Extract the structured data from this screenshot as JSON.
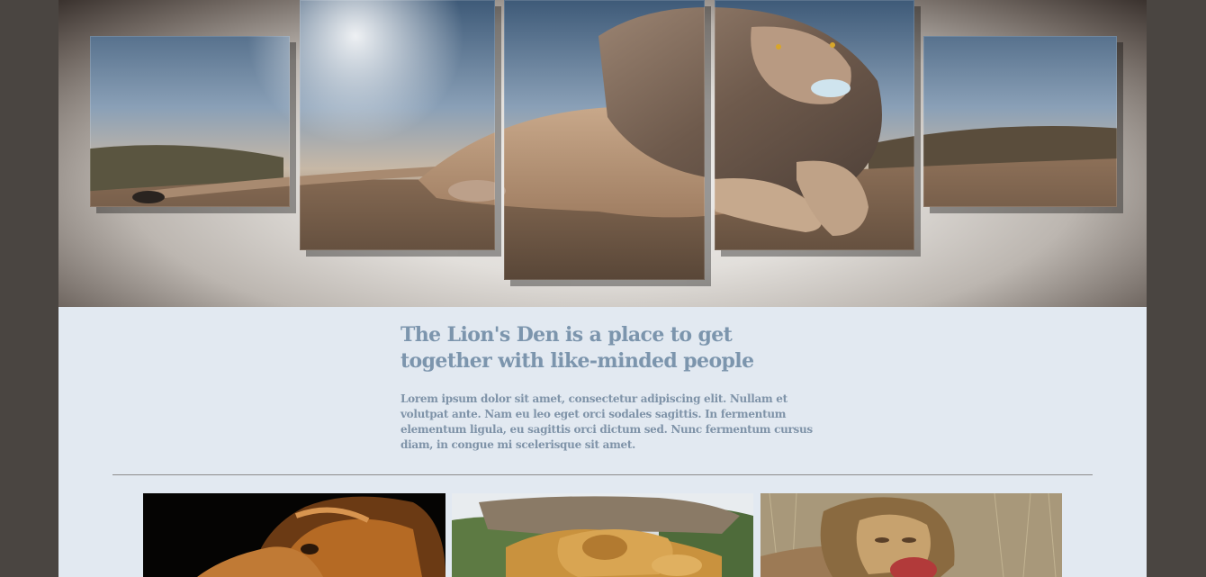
{
  "hero": {
    "image": "lion-canvas-panels-photo"
  },
  "intro": {
    "heading": "The Lion's Den is a place to get together with like-minded people",
    "body": "Lorem ipsum dolor sit amet, consectetur adipiscing elit. Nullam et volutpat ante. Nam eu leo eget orci sodales sagittis. In fermentum elementum ligula, eu sagittis orci dictum sed. Nunc fermentum cursus diam, in congue mi scelerisque sit amet."
  },
  "gallery": {
    "items": [
      {
        "image": "lion-profile-dark-photo"
      },
      {
        "image": "lions-lying-on-log-photo"
      },
      {
        "image": "lion-eating-in-grass-photo"
      }
    ]
  },
  "colors": {
    "background": "#4a4541",
    "page": "#e2e9f1",
    "heading": "#7c95ad",
    "body_text": "#7f93a8",
    "divider": "#8c8c8c"
  }
}
